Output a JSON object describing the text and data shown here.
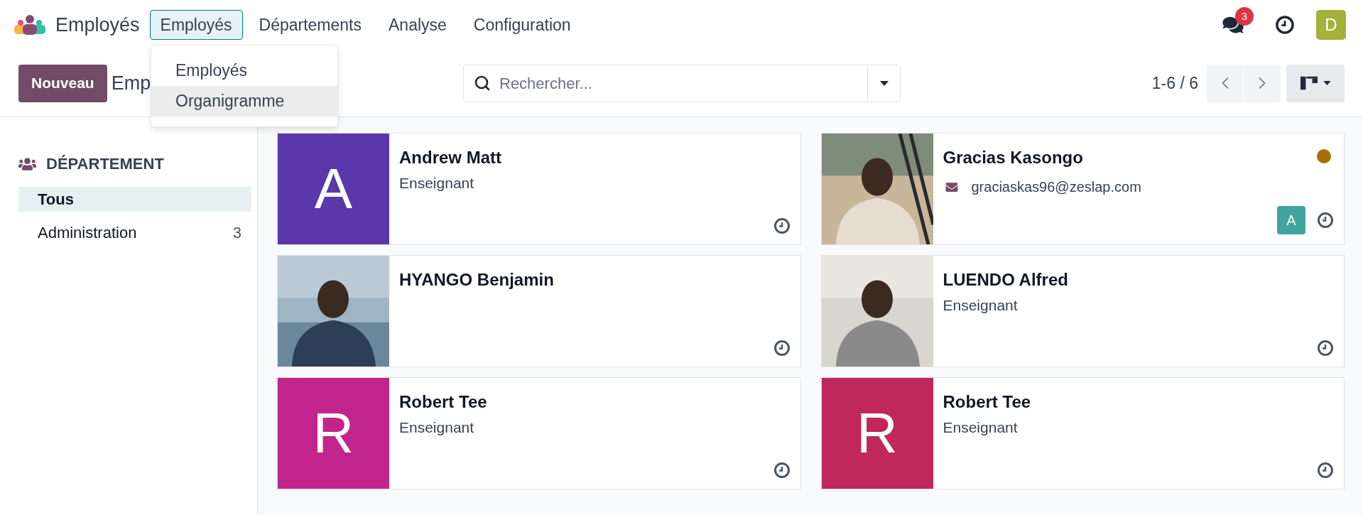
{
  "app": {
    "name": "Employés"
  },
  "menu": [
    {
      "label": "Employés",
      "selected": true
    },
    {
      "label": "Départements",
      "selected": false
    },
    {
      "label": "Analyse",
      "selected": false
    },
    {
      "label": "Configuration",
      "selected": false
    }
  ],
  "dropdown": [
    {
      "label": "Employés",
      "selected": false
    },
    {
      "label": "Organigramme",
      "selected": true
    }
  ],
  "systray": {
    "messages_badge": "3",
    "user_initial": "D"
  },
  "control_bar": {
    "new_button": "Nouveau",
    "breadcrumb": "Emp",
    "search": {
      "placeholder": "Rechercher..."
    },
    "pager": "1-6 / 6"
  },
  "sidebar": {
    "title": "DÉPARTEMENT",
    "items": [
      {
        "label": "Tous",
        "selected": true
      },
      {
        "label": "Administration",
        "count": "3",
        "selected": false
      }
    ]
  },
  "employees": [
    {
      "kind": "initial",
      "initial": "A",
      "color": "#5a37aa",
      "name": "Andrew Matt",
      "job": "Enseignant"
    },
    {
      "kind": "picture",
      "name": "Gracias Kasongo",
      "email": "graciaskas96@zeslap.com",
      "presence": {
        "color": "#a86f00"
      },
      "manager_initial": "A"
    },
    {
      "kind": "picture",
      "name": "HYANGO Benjamin"
    },
    {
      "kind": "picture",
      "name": "LUENDO Alfred",
      "job": "Enseignant"
    },
    {
      "kind": "initial",
      "initial": "R",
      "color": "#c1248c",
      "name": "Robert Tee",
      "job": "Enseignant"
    },
    {
      "kind": "initial",
      "initial": "R",
      "color": "#c0285b",
      "name": "Robert Tee",
      "job": "Enseignant"
    }
  ]
}
